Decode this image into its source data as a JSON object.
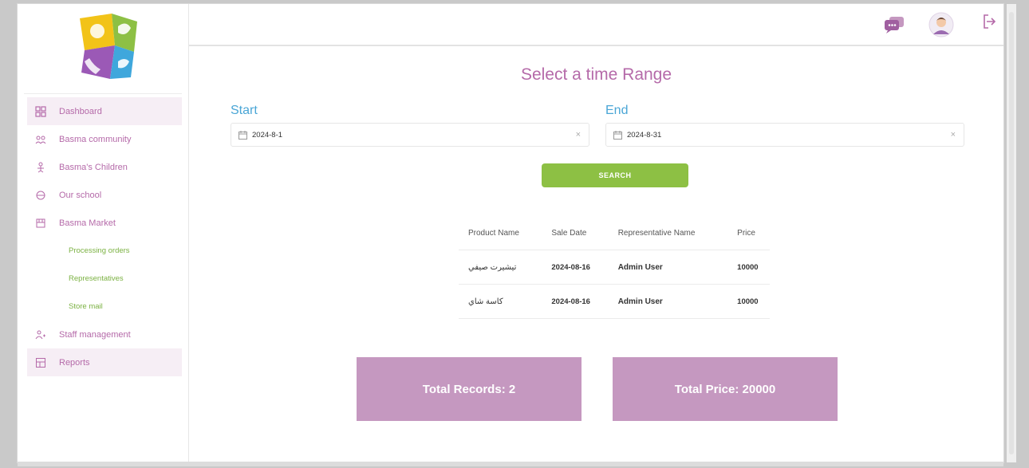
{
  "sidebar": {
    "items": [
      {
        "label": "Dashboard",
        "icon": "grid-icon"
      },
      {
        "label": "Basma community",
        "icon": "community-icon"
      },
      {
        "label": "Basma's Children",
        "icon": "children-icon"
      },
      {
        "label": "Our school",
        "icon": "school-icon"
      },
      {
        "label": "Basma Market",
        "icon": "market-icon"
      }
    ],
    "market_sub": [
      "Processing orders",
      "Representatives",
      "Store mail"
    ],
    "items_bottom": [
      {
        "label": "Staff management",
        "icon": "staff-icon"
      },
      {
        "label": "Reports",
        "icon": "reports-icon"
      }
    ]
  },
  "header": {
    "icons": [
      "chat-icon",
      "avatar-icon",
      "logout-icon"
    ]
  },
  "main": {
    "title": "Select a time Range",
    "start_label": "Start",
    "end_label": "End",
    "start_value": "2024-8-1",
    "end_value": "2024-8-31",
    "clear_symbol": "×",
    "search_label": "SEARCH"
  },
  "table": {
    "headers": [
      "Product Name",
      "Sale Date",
      "Representative Name",
      "Price"
    ],
    "rows": [
      {
        "product": "تيشيرت صيفي",
        "date": "2024-08-16",
        "rep": "Admin User",
        "price": "10000"
      },
      {
        "product": "كاسة شاي",
        "date": "2024-08-16",
        "rep": "Admin User",
        "price": "10000"
      }
    ]
  },
  "stats": {
    "total_records": "Total Records: 2",
    "total_price": "Total Price: 20000"
  },
  "colors": {
    "accent": "#b56aa9",
    "blue": "#4aa6d6",
    "green": "#8dc044",
    "stat_bg": "#c598c0"
  }
}
